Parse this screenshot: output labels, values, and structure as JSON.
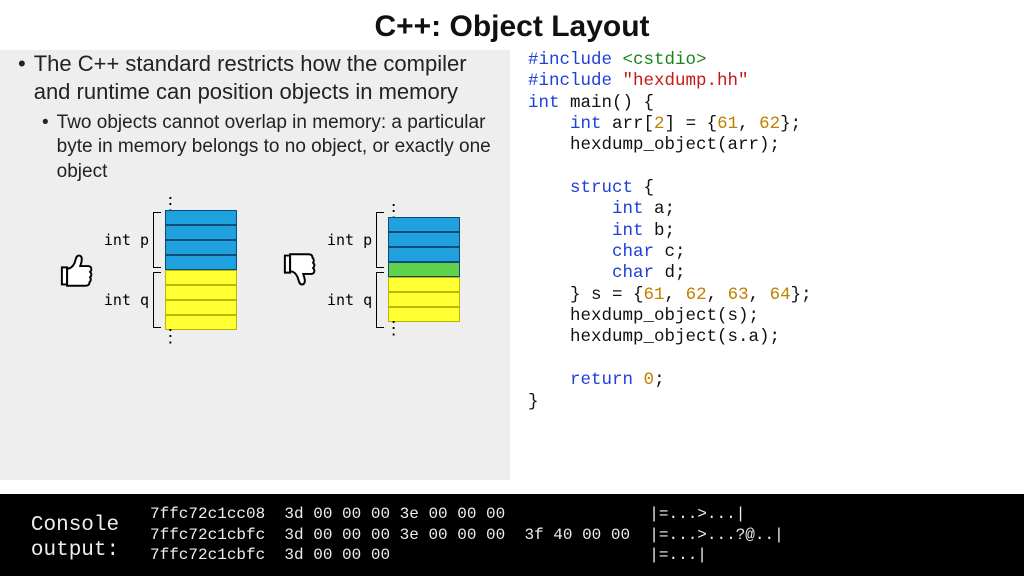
{
  "title": "C++: Object Layout",
  "bullets": {
    "l1": "The C++ standard restricts how the compiler and runtime can position objects in memory",
    "l2": "Two objects cannot overlap in memory: a particular byte in memory belongs to no object, or exactly one object"
  },
  "diagram": {
    "label_p": "int p",
    "label_q": "int q"
  },
  "code": {
    "inc1a": "#include ",
    "inc1b": "<cstdio>",
    "inc2a": "#include ",
    "inc2b": "\"hexdump.hh\"",
    "l3a": "int",
    "l3b": " main() {",
    "l4a": "    ",
    "l4b": "int",
    "l4c": " arr[",
    "l4d": "2",
    "l4e": "] = {",
    "l4f": "61",
    "l4g": ", ",
    "l4h": "62",
    "l4i": "};",
    "l5": "    hexdump_object(arr);",
    "l6": "",
    "l7a": "    ",
    "l7b": "struct",
    "l7c": " {",
    "l8a": "        ",
    "l8b": "int",
    "l8c": " a;",
    "l9a": "        ",
    "l9b": "int",
    "l9c": " b;",
    "l10a": "        ",
    "l10b": "char",
    "l10c": " c;",
    "l11a": "        ",
    "l11b": "char",
    "l11c": " d;",
    "l12a": "    } s = {",
    "l12b": "61",
    "l12c": ", ",
    "l12d": "62",
    "l12e": ", ",
    "l12f": "63",
    "l12g": ", ",
    "l12h": "64",
    "l12i": "};",
    "l13": "    hexdump_object(s);",
    "l14": "    hexdump_object(s.a);",
    "l15": "",
    "l16a": "    ",
    "l16b": "return",
    "l16c": " ",
    "l16d": "0",
    "l16e": ";",
    "l17": "}"
  },
  "console": {
    "label1": "Console",
    "label2": "output:",
    "line1": "7ffc72c1cc08  3d 00 00 00 3e 00 00 00               |=...>...|",
    "line2": "7ffc72c1cbfc  3d 00 00 00 3e 00 00 00  3f 40 00 00  |=...>...?@..|",
    "line3": "7ffc72c1cbfc  3d 00 00 00                           |=...|"
  }
}
